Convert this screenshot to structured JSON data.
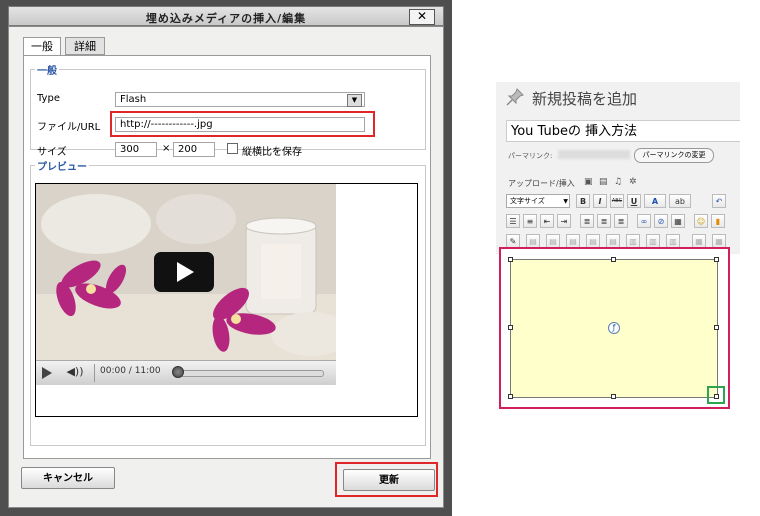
{
  "dialog": {
    "title": "埋め込みメディアの挿入/編集",
    "close_label": "✕",
    "tabs": [
      {
        "label": "一般"
      },
      {
        "label": "詳細"
      }
    ],
    "general": {
      "legend": "一般",
      "type_label": "Type",
      "type_value": "Flash",
      "url_label": "ファイル/URL",
      "url_value": "http://------------.jpg",
      "size_label": "サイズ",
      "width_value": "300",
      "height_value": "200",
      "times": "×",
      "keep_ratio_label": "縦横比を保存"
    },
    "preview": {
      "legend": "プレビュー",
      "time": "00:00 / 11:00"
    },
    "cancel_label": "キャンセル",
    "update_label": "更新",
    "highlight_color": "#e0262a"
  },
  "editor": {
    "heading": "新規投稿を追加",
    "post_title": "You Tubeの 挿入方法",
    "permalink_label": "パーマリンク:",
    "permalink_button": "パーマリンクの変更",
    "upload_label": "アップロード/挿入",
    "font_size_label": "文字サイズ",
    "toolbar_row1": [
      "B",
      "I",
      "ABC",
      "U",
      "A",
      "ab",
      "↶"
    ],
    "content_highlight_color": "#d21e5f",
    "resize_highlight_color": "#2ea44f",
    "embed_background": "#ffffcc"
  }
}
